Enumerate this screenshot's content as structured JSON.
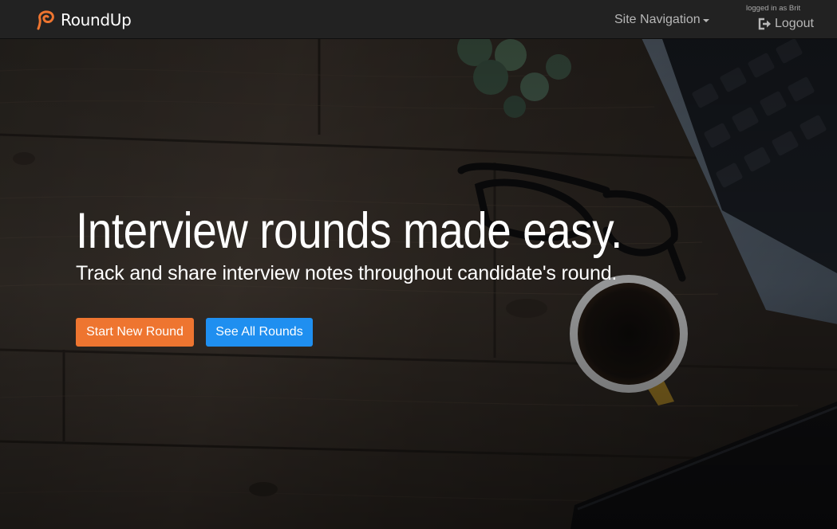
{
  "navbar": {
    "brand_name": "RoundUp",
    "site_navigation_label": "Site Navigation",
    "logged_in_text": "logged in as Brit",
    "logout_label": "Logout"
  },
  "hero": {
    "headline": "Interview rounds made easy.",
    "subheadline": "Track and share interview notes throughout candidate's round.",
    "start_button_label": "Start New Round",
    "all_button_label": "See All Rounds"
  },
  "colors": {
    "brand_accent": "#ee7530",
    "primary_button": "#1f8ff0",
    "navbar_bg": "#222222"
  },
  "icons": {
    "brand": "roundup-logo-icon",
    "caret": "caret-down-icon",
    "logout": "logout-icon"
  }
}
